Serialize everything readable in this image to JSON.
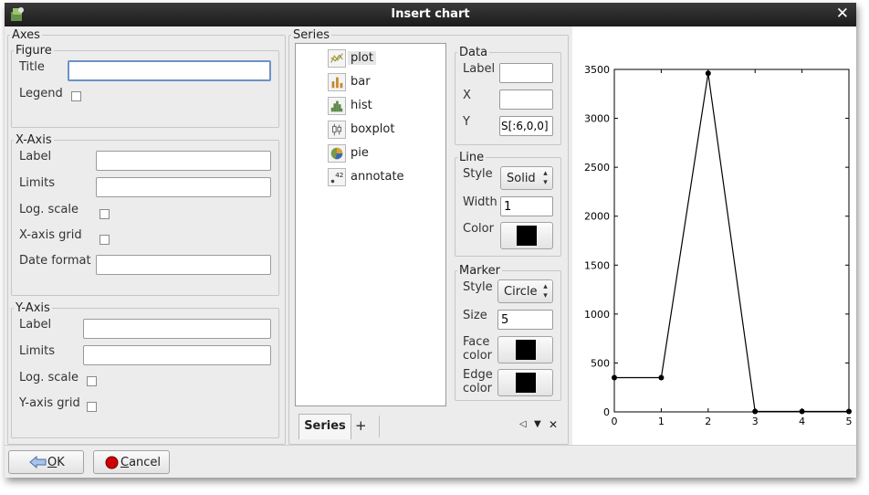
{
  "window": {
    "title": "Insert chart"
  },
  "axes": {
    "legend": "Axes",
    "figure": {
      "legend": "Figure",
      "title_label": "Title",
      "title_value": "",
      "legend_label": "Legend"
    },
    "xaxis": {
      "legend": "X-Axis",
      "label": "Label",
      "limits": "Limits",
      "log_scale": "Log. scale",
      "grid": "X-axis grid",
      "date_format": "Date format"
    },
    "yaxis": {
      "legend": "Y-Axis",
      "label": "Label",
      "limits": "Limits",
      "log_scale": "Log. scale",
      "grid": "Y-axis grid"
    }
  },
  "series": {
    "legend": "Series",
    "items": [
      {
        "label": "plot",
        "icon": "line-plot-icon"
      },
      {
        "label": "bar",
        "icon": "bar-chart-icon"
      },
      {
        "label": "hist",
        "icon": "histogram-icon"
      },
      {
        "label": "boxplot",
        "icon": "boxplot-icon"
      },
      {
        "label": "pie",
        "icon": "pie-chart-icon"
      },
      {
        "label": "annotate",
        "icon": "annotate-icon"
      }
    ],
    "tab_label": "Series",
    "add_tab": "+"
  },
  "data_group": {
    "legend": "Data",
    "label": "Label",
    "x": "X",
    "y": "Y",
    "y_value": "S[:6,0,0]"
  },
  "line_group": {
    "legend": "Line",
    "style_label": "Style",
    "style_value": "Solid",
    "width_label": "Width",
    "width_value": "1",
    "color_label": "Color",
    "color": "#000000"
  },
  "marker_group": {
    "legend": "Marker",
    "style_label": "Style",
    "style_value": "Circle",
    "size_label": "Size",
    "size_value": "5",
    "face_label": "Face\ncolor",
    "face_label_1": "Face",
    "face_label_2": "color",
    "edge_label_1": "Edge",
    "edge_label_2": "color",
    "face_color": "#000000",
    "edge_color": "#000000"
  },
  "buttons": {
    "ok": "OK",
    "ok_mnemonic": "O",
    "ok_rest": "K",
    "cancel": "Cancel",
    "cancel_mnemonic": "C",
    "cancel_rest": "ancel"
  },
  "chart_data": {
    "type": "line",
    "x": [
      0,
      1,
      2,
      3,
      4,
      5
    ],
    "values": [
      350,
      350,
      3460,
      5,
      5,
      5
    ],
    "xlim": [
      0,
      5
    ],
    "ylim": [
      0,
      3500
    ],
    "xticks": [
      0,
      1,
      2,
      3,
      4,
      5
    ],
    "yticks": [
      0,
      500,
      1000,
      1500,
      2000,
      2500,
      3000,
      3500
    ],
    "marker": "circle",
    "line_color": "#000000",
    "grid": false
  }
}
